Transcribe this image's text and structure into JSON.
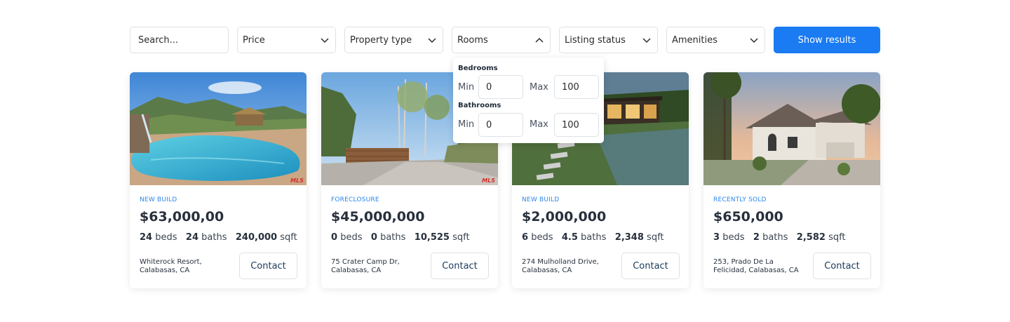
{
  "filters": {
    "search_placeholder": "Search...",
    "price_label": "Price",
    "property_type_label": "Property type",
    "rooms_label": "Rooms",
    "listing_status_label": "Listing status",
    "amenities_label": "Amenities",
    "show_results_label": "Show results"
  },
  "rooms_popover": {
    "bedrooms_title": "Bedrooms",
    "bathrooms_title": "Bathrooms",
    "min_label": "Min",
    "max_label": "Max",
    "bedrooms_min": "0",
    "bedrooms_max": "100",
    "bathrooms_min": "0",
    "bathrooms_max": "100"
  },
  "listings": [
    {
      "status": "NEW BUILD",
      "price": "$63,000,00",
      "beds": "24",
      "beds_unit": "beds",
      "baths": "24",
      "baths_unit": "baths",
      "sqft": "240,000",
      "sqft_unit": "sqft",
      "address_line1": "Whiterock Resort,",
      "address_line2": "Calabasas, CA",
      "contact_label": "Contact",
      "badge": "MLS"
    },
    {
      "status": "FORECLOSURE",
      "price": "$45,000,000",
      "beds": "0",
      "beds_unit": "beds",
      "baths": "0",
      "baths_unit": "baths",
      "sqft": "10,525",
      "sqft_unit": "sqft",
      "address_line1": "75 Crater Camp Dr,",
      "address_line2": "Calabasas, CA",
      "contact_label": "Contact",
      "badge": "MLS"
    },
    {
      "status": "NEW BUILD",
      "price": "$2,000,000",
      "beds": "6",
      "beds_unit": "beds",
      "baths": "4.5",
      "baths_unit": "baths",
      "sqft": "2,348",
      "sqft_unit": "sqft",
      "address_line1": "274 Mulholland Drive,",
      "address_line2": "Calabasas, CA",
      "contact_label": "Contact"
    },
    {
      "status": "RECENTLY SOLD",
      "price": "$650,000",
      "beds": "3",
      "beds_unit": "beds",
      "baths": "2",
      "baths_unit": "baths",
      "sqft": "2,582",
      "sqft_unit": "sqft",
      "address_line1": "253, Prado De La",
      "address_line2": "Felicidad, Calabasas, CA",
      "contact_label": "Contact"
    }
  ],
  "colors": {
    "accent": "#1a7bf2",
    "status_text": "#2a86e9",
    "border": "#dde1e6"
  },
  "icons": {
    "dropdown_closed": "chevron-down-icon",
    "dropdown_open": "chevron-up-icon"
  }
}
